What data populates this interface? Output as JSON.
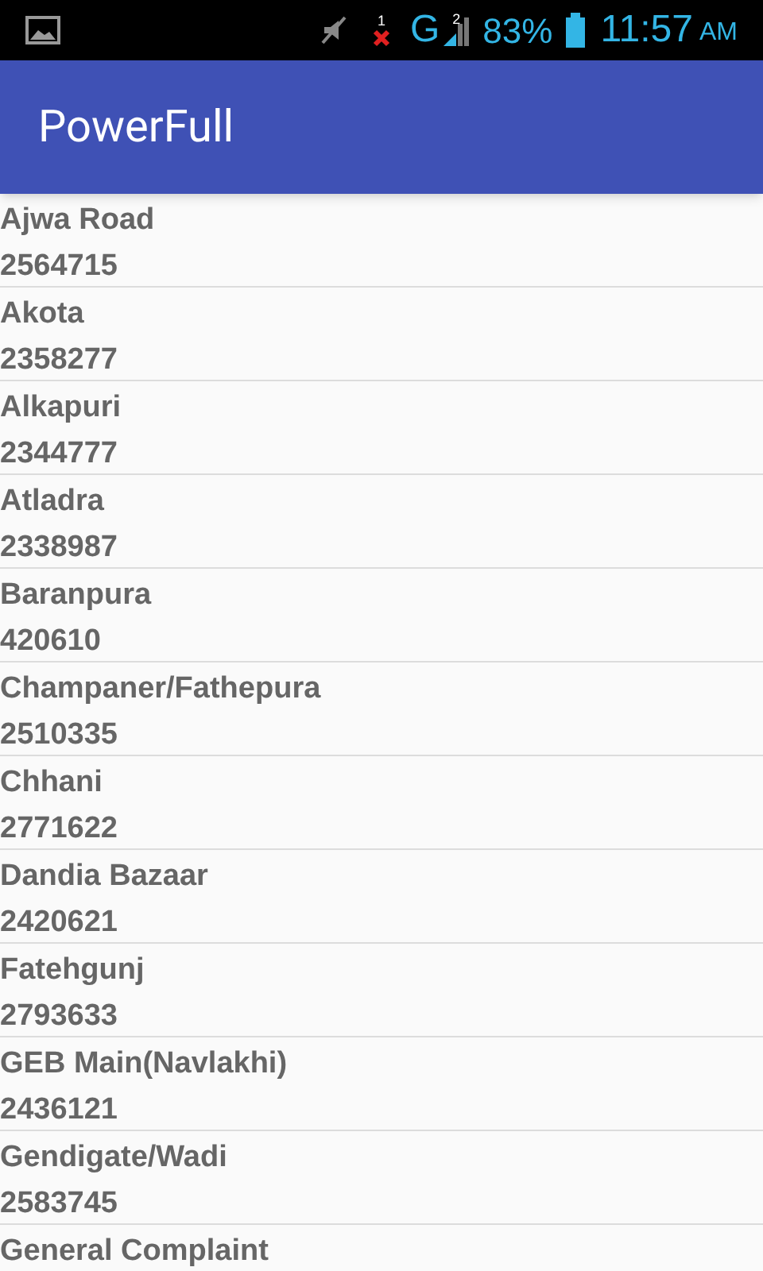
{
  "status_bar": {
    "sim_slot": "1",
    "network": "G",
    "signal_slot": "2",
    "battery": "83%",
    "time": "11:57",
    "meridiem": "AM"
  },
  "app_bar": {
    "title": "PowerFull"
  },
  "items": [
    {
      "name": "Ajwa Road",
      "number": "2564715"
    },
    {
      "name": "Akota",
      "number": "2358277"
    },
    {
      "name": "Alkapuri",
      "number": "2344777"
    },
    {
      "name": "Atladra",
      "number": "2338987"
    },
    {
      "name": "Baranpura",
      "number": "420610"
    },
    {
      "name": "Champaner/Fathepura",
      "number": "2510335"
    },
    {
      "name": "Chhani",
      "number": "2771622"
    },
    {
      "name": "Dandia Bazaar",
      "number": "2420621"
    },
    {
      "name": "Fatehgunj",
      "number": "2793633"
    },
    {
      "name": "GEB Main(Navlakhi)",
      "number": "2436121"
    },
    {
      "name": "Gendigate/Wadi",
      "number": "2583745"
    },
    {
      "name": "General Complaint"
    }
  ]
}
